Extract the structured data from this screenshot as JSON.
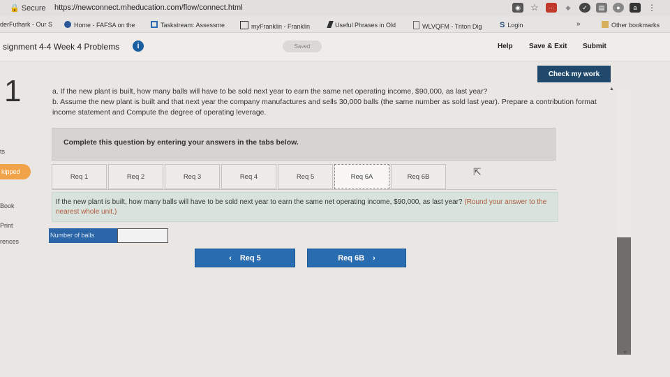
{
  "browser": {
    "secure_label": "Secure",
    "url": "https://newconnect.mheducation.com/flow/connect.html"
  },
  "bookmarks": {
    "items": [
      "derFuthark - Our S",
      "Home - FAFSA on the",
      "Taskstream: Assessme",
      "myFranklin - Franklin",
      "Useful Phrases in Old",
      "WLVQFM - Triton Dig",
      "Login"
    ],
    "overflow": "»",
    "other": "Other bookmarks"
  },
  "header": {
    "assignment_title": "signment 4-4 Week 4 Problems",
    "info_icon": "i",
    "saved": "Saved",
    "help": "Help",
    "save_exit": "Save & Exit",
    "submit": "Submit"
  },
  "left_nav": {
    "items": [
      "ts",
      "Book",
      "Print",
      "rences"
    ],
    "skipped": "kipped"
  },
  "question": {
    "number": "1",
    "check_my_work": "Check my work",
    "line_a": "a. If the new plant is built, how many balls will have to be sold next year to earn the same net operating income, $90,000, as last year?",
    "line_b": "b. Assume the new plant is built and that next year the company manufactures and sells 30,000 balls (the same number as sold last year). Prepare a contribution format income statement and Compute the degree of operating leverage."
  },
  "tabs_section": {
    "instruction": "Complete this question by entering your answers in the tabs below.",
    "tabs": [
      "Req 1",
      "Req 2",
      "Req 3",
      "Req 4",
      "Req 5",
      "Req 6A",
      "Req 6B"
    ],
    "active_tab": "Req 6A"
  },
  "answer": {
    "prompt": "If the new plant is built, how many balls will have to be sold next year to earn the same net operating income, $90,000, as last year?",
    "hint": "(Round your answer to the nearest whole unit.)",
    "field_label": "Number of balls",
    "field_value": ""
  },
  "navigation": {
    "prev_label": "Req 5",
    "prev_arrow": "‹",
    "next_label": "Req 6B",
    "next_arrow": "›"
  }
}
